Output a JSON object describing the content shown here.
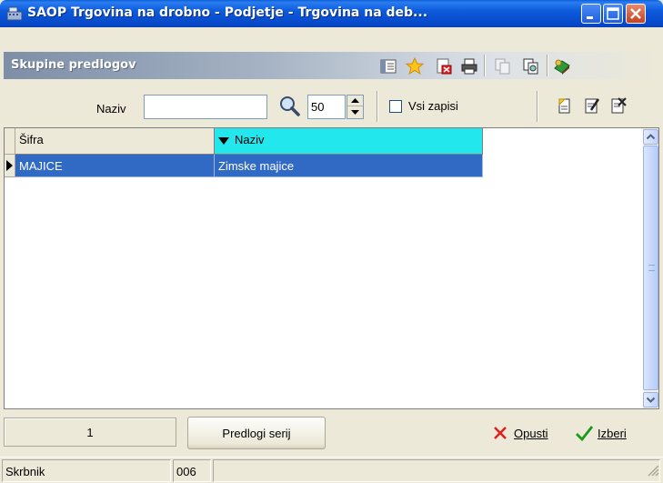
{
  "window": {
    "title": "SAOP Trgovina na drobno - Podjetje - Trgovina na deb...",
    "icon": "cash-register-icon"
  },
  "panel": {
    "title": "Skupine predlogov"
  },
  "filter": {
    "name_label": "Naziv",
    "name_value": "",
    "count_value": "50",
    "all_records_label": "Vsi zapisi",
    "all_records_checked": false
  },
  "grid": {
    "columns": [
      "Šifra",
      "Naziv"
    ],
    "sorted_column": "Naziv",
    "rows": [
      {
        "sifra": "MAJICE",
        "naziv": "Zimske majice",
        "selected": true
      }
    ]
  },
  "bottom": {
    "record_count": "1",
    "templates_button": "Predlogi serij",
    "cancel_button": "Opusti",
    "select_button": "Izberi"
  },
  "status": {
    "user": "Skrbnik",
    "code": "006"
  },
  "colors": {
    "titlebar": "#0a5fd8",
    "selection": "#316ac5",
    "sorted_header": "#22e8ee",
    "window_bg": "#ece9d8"
  }
}
